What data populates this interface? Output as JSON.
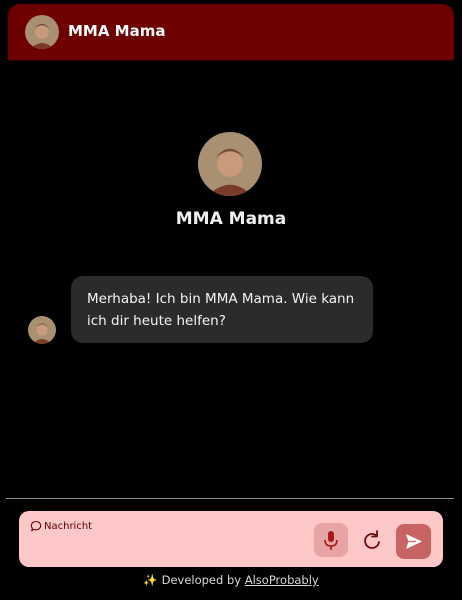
{
  "header": {
    "title": "MMA Mama"
  },
  "bot": {
    "name": "MMA Mama"
  },
  "messages": [
    {
      "role": "assistant",
      "text": "Merhaba! Ich bin MMA Mama. Wie kann ich dir heute helfen?"
    }
  ],
  "composer": {
    "placeholder": "Nachricht"
  },
  "footer": {
    "prefix": "Developed by",
    "link_text": "AlsoProbably"
  },
  "icons": {
    "header_avatar": "avatar-icon",
    "chat": "chat-bubble-icon",
    "mic": "microphone-icon",
    "redo": "redo-icon",
    "send": "send-icon",
    "sparkle": "sparkle-icon"
  },
  "colors": {
    "header_bg": "#6e0000",
    "composer_bg": "#ffc8c8",
    "send_button": "#c86464",
    "bubble_bg": "#2b2b2b"
  }
}
